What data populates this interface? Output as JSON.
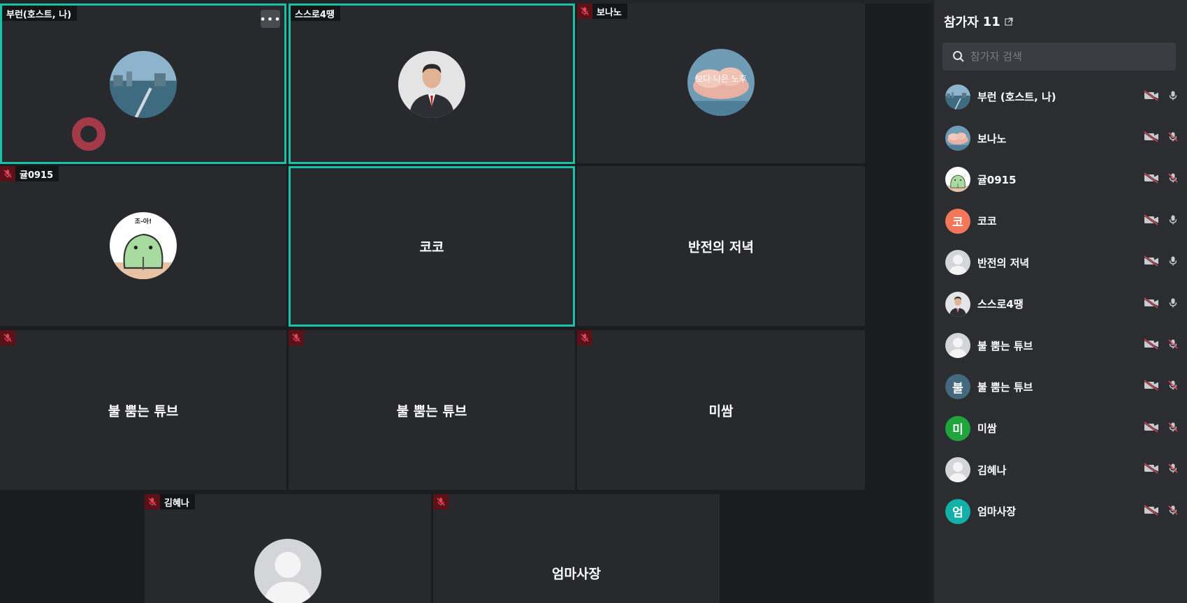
{
  "tiles": {
    "t1": {
      "name": "부런(호스트, 나)"
    },
    "t2": {
      "name": "스스로4땡"
    },
    "t3": {
      "name": "보나노",
      "avatar_text": "보다 나은 노후"
    },
    "t4": {
      "name": "귤0915",
      "avatar_text": "조-아!"
    },
    "t5": {
      "name": "코코"
    },
    "t6": {
      "name": "반전의 저녁"
    },
    "t7": {
      "name": "불 뿜는 튜브"
    },
    "t8": {
      "name": "불 뿜는 튜브"
    },
    "t9": {
      "name": "미쌈"
    },
    "t10": {
      "name": "김혜나"
    },
    "t11": {
      "name": "엄마사장"
    }
  },
  "panel": {
    "title": "참가자",
    "count": "11",
    "search_placeholder": "참가자 검색",
    "participants": [
      {
        "name": "부런 (호스트, 나)",
        "initial": ""
      },
      {
        "name": "보나노",
        "initial": ""
      },
      {
        "name": "귤0915",
        "initial": ""
      },
      {
        "name": "코코",
        "initial": "코"
      },
      {
        "name": "반전의 저녁",
        "initial": ""
      },
      {
        "name": "스스로4땡",
        "initial": ""
      },
      {
        "name": "불 뿜는 튜브",
        "initial": ""
      },
      {
        "name": "불 뿜는 튜브",
        "initial": "불"
      },
      {
        "name": "미쌈",
        "initial": "미"
      },
      {
        "name": "김혜나",
        "initial": ""
      },
      {
        "name": "엄마사장",
        "initial": "엄"
      }
    ]
  },
  "colors": {
    "accent": "#19c2a7",
    "tile_bg": "#28292d",
    "mute_bg": "#5a1218",
    "mute_icon": "#e0455a",
    "koko_avatar": "#f4775c",
    "bul_avatar": "#44687e",
    "missam_avatar": "#1fa53c",
    "eomma_avatar": "#12b0a6"
  }
}
